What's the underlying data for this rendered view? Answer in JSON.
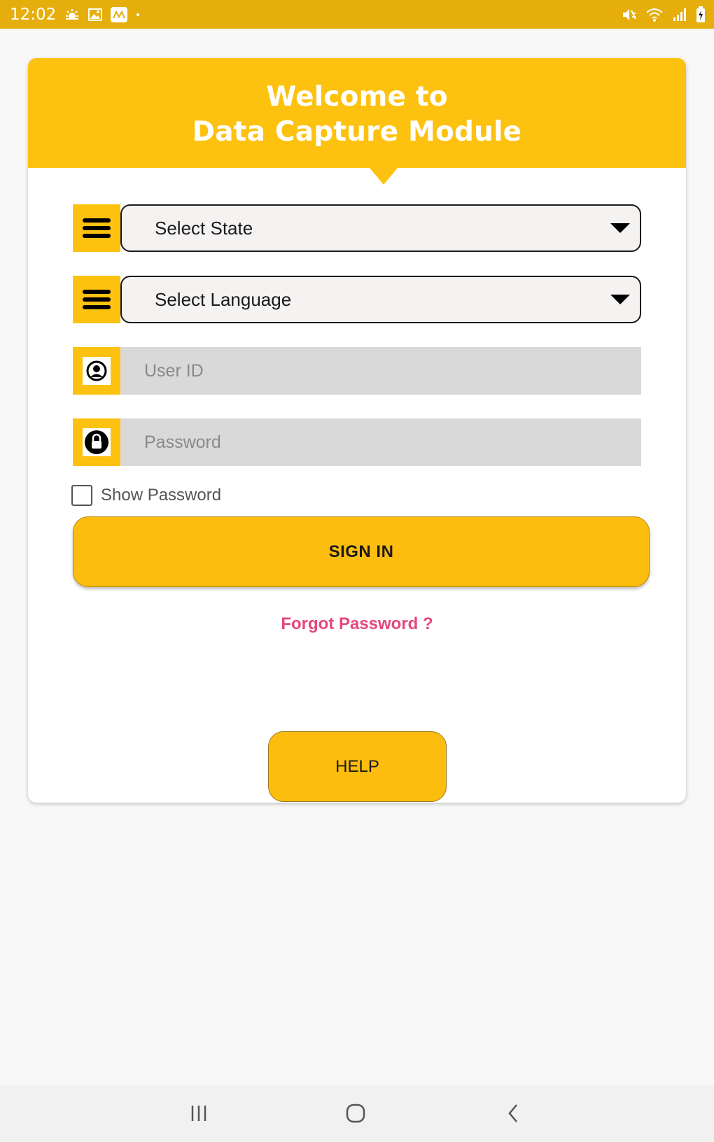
{
  "status_bar": {
    "time": "12:02",
    "left_icons": [
      "weather-sun-icon",
      "gallery-icon",
      "app-notification-icon",
      "dot-icon"
    ],
    "right_icons": [
      "mute-vibrate-icon",
      "wifi-icon",
      "signal-icon",
      "battery-charging-icon"
    ]
  },
  "header": {
    "line1": "Welcome to",
    "line2": "Data Capture Module"
  },
  "form": {
    "state_select": {
      "value": "Select State",
      "icon": "list-icon"
    },
    "language_select": {
      "value": "Select Language",
      "icon": "list-icon"
    },
    "user_id": {
      "placeholder": "User ID",
      "value": "",
      "icon": "user-icon"
    },
    "password": {
      "placeholder": "Password",
      "value": "",
      "icon": "lock-icon"
    },
    "show_password_label": "Show Password",
    "sign_in_label": "SIGN IN",
    "forgot_password_label": "Forgot Password ?",
    "help_label": "HELP"
  },
  "nav_bar": {
    "buttons": [
      "recents-icon",
      "home-icon",
      "back-icon"
    ]
  },
  "colors": {
    "status_bar": "#e5ae0c",
    "accent": "#fdc20f",
    "button": "#fdbd0e",
    "link": "#e5477c",
    "input_bg": "#d9d9d9"
  }
}
